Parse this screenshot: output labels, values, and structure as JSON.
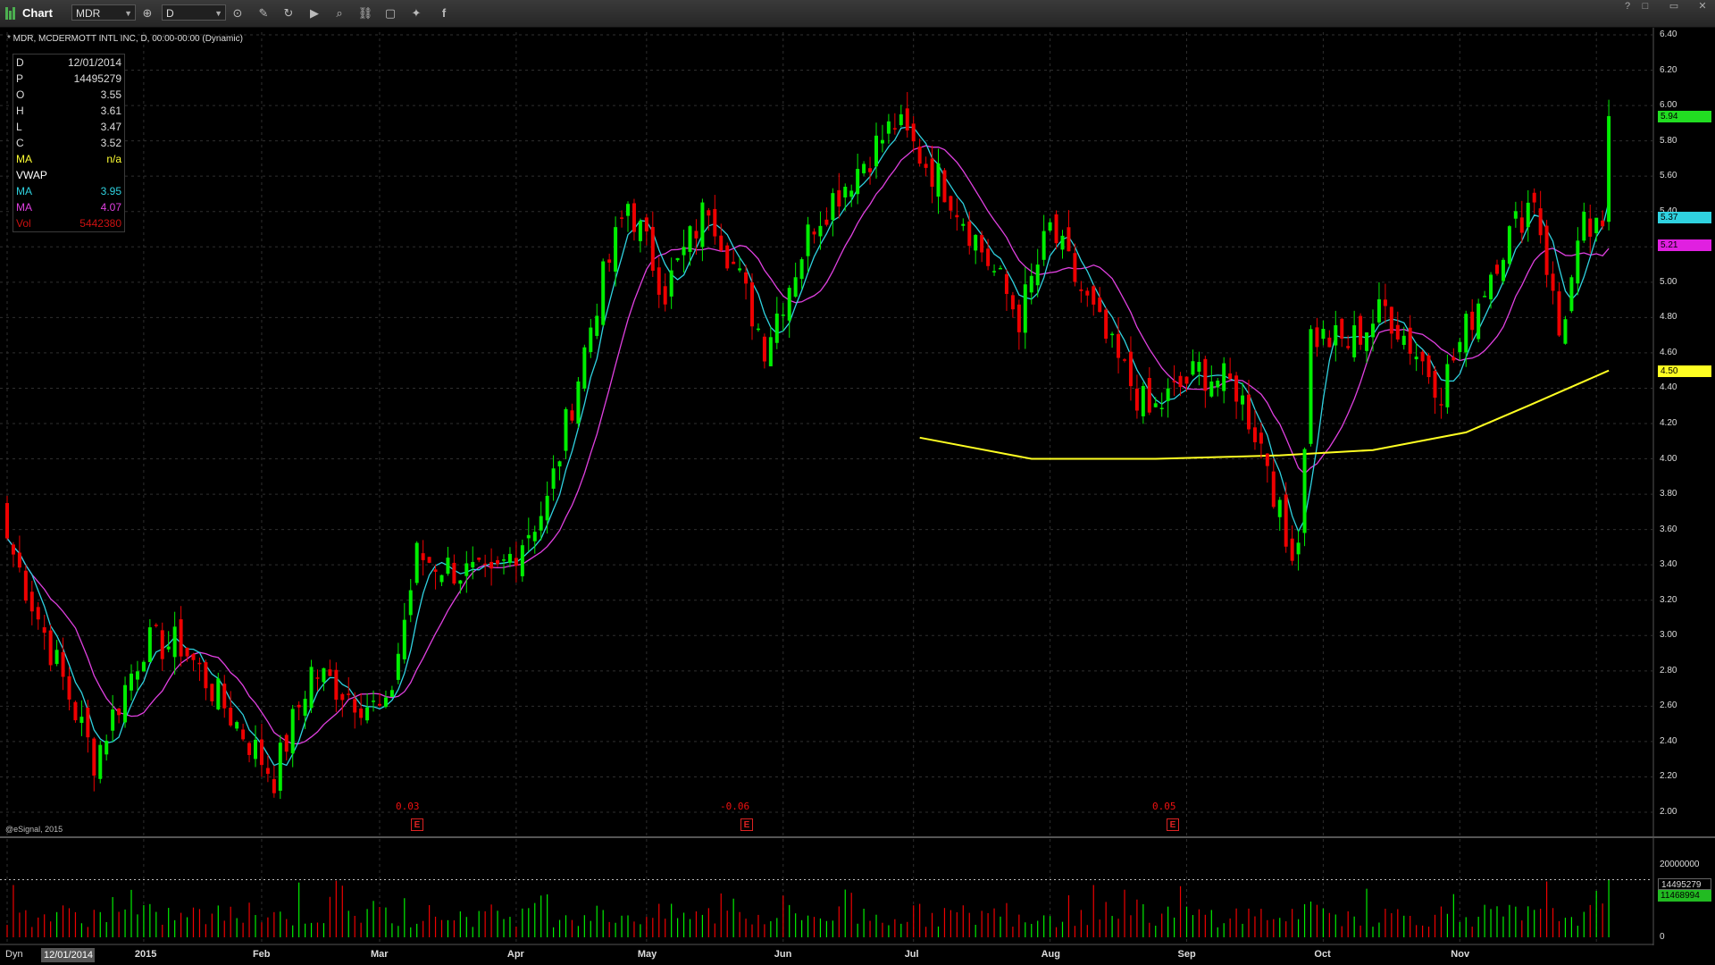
{
  "window": {
    "title": "Chart",
    "symbol_value": "MDR",
    "interval_value": "D",
    "controls": [
      "?",
      "□",
      "▭",
      "✕"
    ]
  },
  "chart": {
    "label": "* MDR, MCDERMOTT INTL INC, D, 00:00-00:00 (Dynamic)",
    "copyright": "@eSignal, 2015",
    "datawindow": [
      {
        "k": "D",
        "v": "12/01/2014",
        "color": "#dddddd"
      },
      {
        "k": "P",
        "v": "14495279",
        "color": "#dddddd"
      },
      {
        "k": "O",
        "v": "3.55",
        "color": "#dddddd"
      },
      {
        "k": "H",
        "v": "3.61",
        "color": "#dddddd"
      },
      {
        "k": "L",
        "v": "3.47",
        "color": "#dddddd"
      },
      {
        "k": "C",
        "v": "3.52",
        "color": "#dddddd"
      },
      {
        "k": "MA",
        "v": "n/a",
        "color": "#ffff33"
      },
      {
        "k": "VWAP",
        "v": "",
        "color": "#ffffff"
      },
      {
        "k": "MA",
        "v": "3.95",
        "color": "#2fd2e0"
      },
      {
        "k": "MA",
        "v": "4.07",
        "color": "#e040e0"
      },
      {
        "k": "Vol",
        "v": "5442380",
        "color": "#cc1111"
      }
    ],
    "earnings": [
      {
        "value": "0.03"
      },
      {
        "value": "-0.06"
      },
      {
        "value": "0.05"
      }
    ],
    "earnings_icon": "E",
    "x_labels": [
      "2015",
      "Feb",
      "Mar",
      "Apr",
      "May",
      "Jun",
      "Jul",
      "Aug",
      "Sep",
      "Oct",
      "Nov"
    ],
    "price_ticks": [
      "6.40",
      "6.20",
      "6.00",
      "5.80",
      "5.60",
      "5.40",
      "5.20",
      "5.00",
      "4.80",
      "4.60",
      "4.40",
      "4.20",
      "4.00",
      "3.80",
      "3.60",
      "3.40",
      "3.20",
      "3.00",
      "2.80",
      "2.60",
      "2.40",
      "2.20",
      "2.00"
    ],
    "volume_ticks": [
      "20000000",
      "0"
    ],
    "price_tags": [
      {
        "text": "5.94",
        "bg": "#22dd22",
        "fg": "#000000"
      },
      {
        "text": "5.37",
        "bg": "#2fd2e0",
        "fg": "#000000"
      },
      {
        "text": "5.21",
        "bg": "#e020e0",
        "fg": "#000000"
      },
      {
        "text": "4.50",
        "bg": "#ffff22",
        "fg": "#000000"
      }
    ],
    "volume_tags": [
      {
        "text": "14495279",
        "bg": "#000000",
        "fg": "#ffffff"
      },
      {
        "text": "11468994",
        "bg": "#22bb22",
        "fg": "#000000"
      }
    ],
    "bottom": {
      "mode": "Dyn",
      "date": "12/01/2014"
    },
    "colors": {
      "up": "#00ee00",
      "down": "#ee0000",
      "ma_fast": "#2fd2e0",
      "ma_slow": "#e040e0",
      "ma_long": "#ffff22"
    }
  },
  "chart_data": {
    "type": "candlestick",
    "title": "MDR, MCDERMOTT INTL INC, D",
    "ylim": [
      2.0,
      6.4
    ],
    "x_labels": [
      "2015",
      "Feb",
      "Mar",
      "Apr",
      "May",
      "Jun",
      "Jul",
      "Aug",
      "Sep",
      "Oct",
      "Nov"
    ],
    "anchors": [
      {
        "i": 0,
        "c": 3.55
      },
      {
        "i": 14,
        "c": 2.3
      },
      {
        "i": 22,
        "c": 2.95
      },
      {
        "i": 28,
        "c": 2.95
      },
      {
        "i": 43,
        "c": 2.2
      },
      {
        "i": 49,
        "c": 2.8
      },
      {
        "i": 61,
        "c": 2.55
      },
      {
        "i": 66,
        "c": 3.45
      },
      {
        "i": 78,
        "c": 3.3
      },
      {
        "i": 87,
        "c": 3.75
      },
      {
        "i": 95,
        "c": 4.9
      },
      {
        "i": 100,
        "c": 5.45
      },
      {
        "i": 106,
        "c": 4.95
      },
      {
        "i": 113,
        "c": 5.45
      },
      {
        "i": 122,
        "c": 4.65
      },
      {
        "i": 130,
        "c": 5.35
      },
      {
        "i": 143,
        "c": 5.9
      },
      {
        "i": 152,
        "c": 5.5
      },
      {
        "i": 163,
        "c": 4.8
      },
      {
        "i": 168,
        "c": 5.3
      },
      {
        "i": 178,
        "c": 4.6
      },
      {
        "i": 184,
        "c": 4.25
      },
      {
        "i": 192,
        "c": 4.5
      },
      {
        "i": 198,
        "c": 4.4
      },
      {
        "i": 203,
        "c": 4.0
      },
      {
        "i": 206,
        "c": 3.5
      },
      {
        "i": 208,
        "c": 3.55
      },
      {
        "i": 210,
        "c": 4.7
      },
      {
        "i": 216,
        "c": 4.65
      },
      {
        "i": 222,
        "c": 4.85
      },
      {
        "i": 231,
        "c": 4.4
      },
      {
        "i": 240,
        "c": 5.15
      },
      {
        "i": 246,
        "c": 5.5
      },
      {
        "i": 250,
        "c": 4.7
      },
      {
        "i": 254,
        "c": 5.3
      },
      {
        "i": 257,
        "c": 5.25
      },
      {
        "i": 258,
        "c": 5.94
      }
    ],
    "ma_long": [
      {
        "i": 147,
        "c": 4.12
      },
      {
        "i": 165,
        "c": 4.0
      },
      {
        "i": 185,
        "c": 4.0
      },
      {
        "i": 205,
        "c": 4.02
      },
      {
        "i": 220,
        "c": 4.05
      },
      {
        "i": 235,
        "c": 4.15
      },
      {
        "i": 245,
        "c": 4.3
      },
      {
        "i": 258,
        "c": 4.5
      }
    ],
    "volume_ylim": [
      0,
      20000000
    ],
    "last_volume": 14495279,
    "avg_volume": 11468994
  }
}
